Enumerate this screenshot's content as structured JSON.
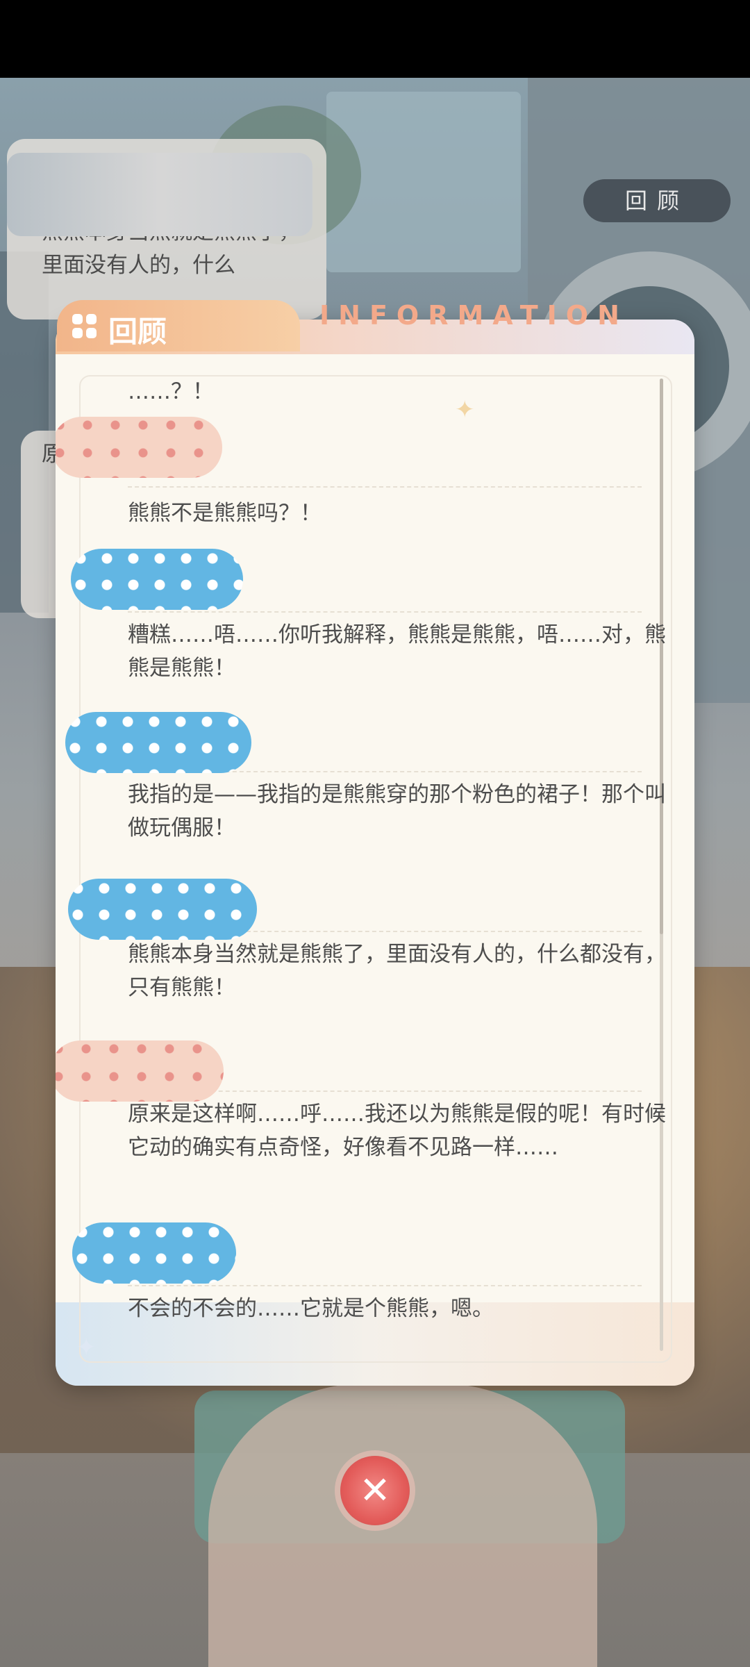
{
  "background": {
    "bubble_text_1": "熊熊本身当然就是熊熊了，里面没有人的，什么",
    "bubble_text_2": "原"
  },
  "top_button": {
    "label": "回顾"
  },
  "dialog": {
    "title": "回顾",
    "decor_word": "INFORMATION",
    "entries": [
      {
        "speaker_style": "pink",
        "text": "……？！"
      },
      {
        "speaker_style": "pink",
        "text": "熊熊不是熊熊吗？！"
      },
      {
        "speaker_style": "blue",
        "text": "糟糕……唔……你听我解释，熊熊是熊熊，唔……对，熊熊是熊熊！"
      },
      {
        "speaker_style": "blue",
        "text": "我指的是——我指的是熊熊穿的那个粉色的裙子！那个叫做玩偶服！"
      },
      {
        "speaker_style": "blue",
        "text": "熊熊本身当然就是熊熊了，里面没有人的，什么都没有，只有熊熊！"
      },
      {
        "speaker_style": "pink",
        "text": "原来是这样啊……呼……我还以为熊熊是假的呢！有时候它动的确实有点奇怪，好像看不见路一样……"
      },
      {
        "speaker_style": "blue",
        "text": "不会的不会的……它就是个熊熊，嗯。"
      }
    ]
  },
  "colors": {
    "accent": "#f2b58a",
    "close": "#e35c5a",
    "speaker_blue": "#62b6e3",
    "speaker_pink": "#f6d4c5"
  },
  "icons": {
    "title": "grid-icon",
    "close": "close-icon"
  }
}
